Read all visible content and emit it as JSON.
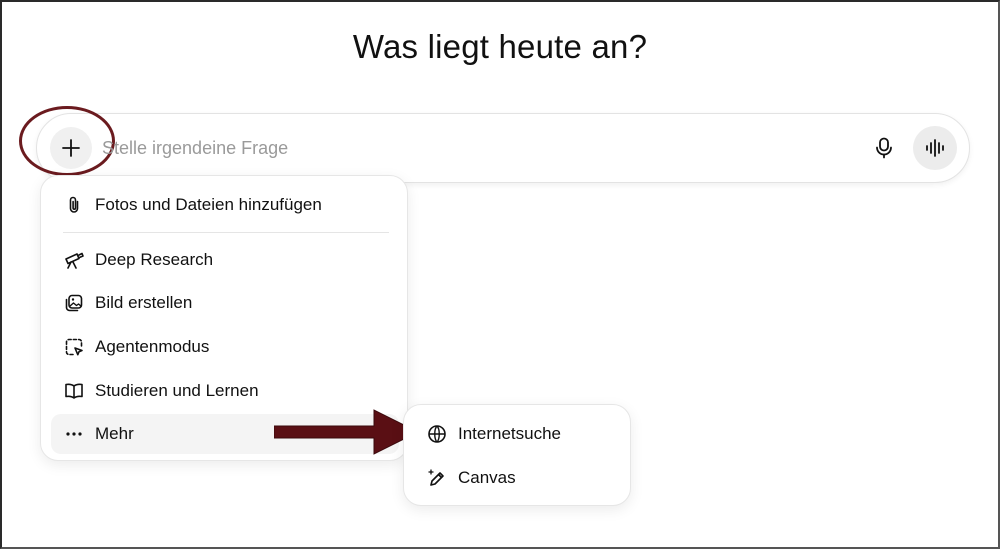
{
  "page": {
    "title": "Was liegt heute an?"
  },
  "composer": {
    "placeholder": "Stelle irgendeine Frage",
    "value": "",
    "plus_icon": "plus-icon",
    "mic_icon": "microphone-icon",
    "voice_icon": "voice-waveform-icon"
  },
  "menu": {
    "items": [
      {
        "label": "Fotos und Dateien hinzufügen",
        "icon": "paperclip-icon"
      },
      {
        "label": "Deep Research",
        "icon": "telescope-icon"
      },
      {
        "label": "Bild erstellen",
        "icon": "image-icon"
      },
      {
        "label": "Agentenmodus",
        "icon": "agent-cursor-icon"
      },
      {
        "label": "Studieren und Lernen",
        "icon": "book-icon"
      },
      {
        "label": "Mehr",
        "icon": "more-dots-icon"
      }
    ]
  },
  "submenu": {
    "items": [
      {
        "label": "Internetsuche",
        "icon": "globe-icon"
      },
      {
        "label": "Canvas",
        "icon": "pencil-sparkle-icon"
      }
    ]
  },
  "annotations": {
    "highlight_color": "#6b1b1f",
    "arrow_color": "#5a0f14"
  }
}
